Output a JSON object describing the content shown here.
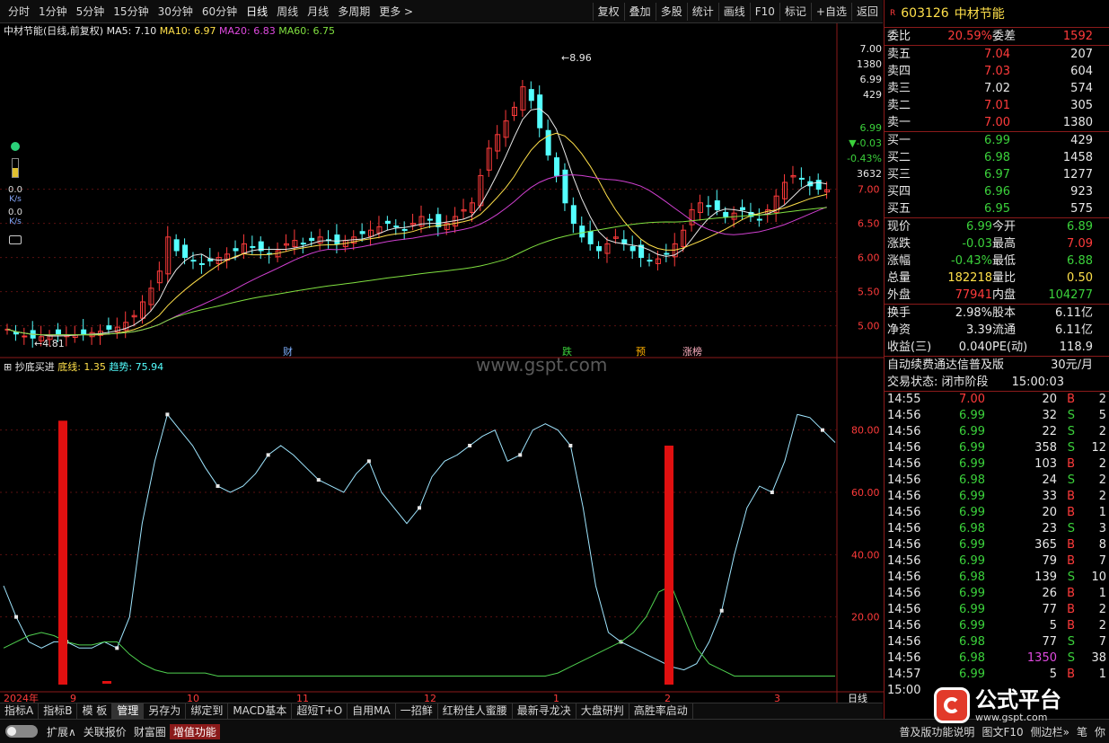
{
  "toolbar": {
    "left": [
      "分时",
      "1分钟",
      "5分钟",
      "15分钟",
      "30分钟",
      "60分钟",
      "日线",
      "周线",
      "月线",
      "多周期",
      "更多 >"
    ],
    "right": [
      "复权",
      "叠加",
      "多股",
      "统计",
      "画线",
      "F10",
      "标记",
      "+自选",
      "返回"
    ]
  },
  "chart_header": {
    "name": "中材节能",
    "mode": "(日线,前复权)",
    "ma5": "MA5: 7.10",
    "ma10": "MA10: 6.97",
    "ma20": "MA20: 6.83",
    "ma60": "MA60: 6.75"
  },
  "price_axis": [
    "7.00",
    "6.50",
    "6.00",
    "5.50",
    "5.00"
  ],
  "hover_box": [
    "7.00",
    "1380",
    "6.99",
    "429",
    "6.99",
    "-0.03",
    "-0.43%",
    "3632"
  ],
  "annotations": {
    "high": "8.96",
    "low": "4.81",
    "cai": "财",
    "die": "跌",
    "yu": "预",
    "zhangbang": "涨榜"
  },
  "indicator_header": {
    "name": "抄底买进",
    "base": "底线: 1.35",
    "trend": "趋势: 75.94"
  },
  "indicator_axis": [
    "80.00",
    "60.00",
    "40.00",
    "20.00"
  ],
  "x_axis": [
    "2024年",
    "9",
    "10",
    "11",
    "12",
    "1",
    "2",
    "3"
  ],
  "x_axis_unit": "日线",
  "watermark": "www.gspt.com",
  "side_tools": {
    "v1": "0.0",
    "u1": "K/s",
    "v2": "0.0",
    "u2": "K/s"
  },
  "stock": {
    "code": "603126",
    "name": "中材节能"
  },
  "weibi": {
    "label1": "委比",
    "val1": "20.59%",
    "label2": "委差",
    "val2": "1592"
  },
  "asks": [
    {
      "label": "卖五",
      "price": "7.04",
      "vol": "207"
    },
    {
      "label": "卖四",
      "price": "7.03",
      "vol": "604"
    },
    {
      "label": "卖三",
      "price": "7.02",
      "vol": "574"
    },
    {
      "label": "卖二",
      "price": "7.01",
      "vol": "305"
    },
    {
      "label": "卖一",
      "price": "7.00",
      "vol": "1380"
    }
  ],
  "bids": [
    {
      "label": "买一",
      "price": "6.99",
      "vol": "429"
    },
    {
      "label": "买二",
      "price": "6.98",
      "vol": "1458"
    },
    {
      "label": "买三",
      "price": "6.97",
      "vol": "1277"
    },
    {
      "label": "买四",
      "price": "6.96",
      "vol": "923"
    },
    {
      "label": "买五",
      "price": "6.95",
      "vol": "575"
    }
  ],
  "quote": [
    {
      "l1": "现价",
      "v1": "6.99",
      "l2": "今开",
      "v2": "6.89"
    },
    {
      "l1": "涨跌",
      "v1": "-0.03",
      "l2": "最高",
      "v2": "7.09"
    },
    {
      "l1": "涨幅",
      "v1": "-0.43%",
      "l2": "最低",
      "v2": "6.88"
    },
    {
      "l1": "总量",
      "v1": "182218",
      "l2": "量比",
      "v2": "0.50"
    },
    {
      "l1": "外盘",
      "v1": "77941",
      "l2": "内盘",
      "v2": "104277"
    }
  ],
  "fund": [
    {
      "l1": "换手",
      "v1": "2.98%",
      "l2": "股本",
      "v2": "6.11亿"
    },
    {
      "l1": "净资",
      "v1": "3.39",
      "l2": "流通",
      "v2": "6.11亿"
    },
    {
      "l1": "收益(三)",
      "v1": "0.040",
      "l2": "PE(动)",
      "v2": "118.9"
    }
  ],
  "service": {
    "text": "自动续费通达信普及版",
    "price": "30元/月"
  },
  "trade_status": {
    "label": "交易状态: 闭市阶段",
    "time": "15:00:03"
  },
  "ticks": [
    {
      "t": "14:55",
      "p": "7.00",
      "v": "20",
      "s": "B",
      "n": "2"
    },
    {
      "t": "14:56",
      "p": "6.99",
      "v": "32",
      "s": "S",
      "n": "5"
    },
    {
      "t": "14:56",
      "p": "6.99",
      "v": "22",
      "s": "S",
      "n": "2"
    },
    {
      "t": "14:56",
      "p": "6.99",
      "v": "358",
      "s": "S",
      "n": "12"
    },
    {
      "t": "14:56",
      "p": "6.99",
      "v": "103",
      "s": "B",
      "n": "2"
    },
    {
      "t": "14:56",
      "p": "6.98",
      "v": "24",
      "s": "S",
      "n": "2"
    },
    {
      "t": "14:56",
      "p": "6.99",
      "v": "33",
      "s": "B",
      "n": "2"
    },
    {
      "t": "14:56",
      "p": "6.99",
      "v": "20",
      "s": "B",
      "n": "1"
    },
    {
      "t": "14:56",
      "p": "6.98",
      "v": "23",
      "s": "S",
      "n": "3"
    },
    {
      "t": "14:56",
      "p": "6.99",
      "v": "365",
      "s": "B",
      "n": "8"
    },
    {
      "t": "14:56",
      "p": "6.99",
      "v": "79",
      "s": "B",
      "n": "7"
    },
    {
      "t": "14:56",
      "p": "6.98",
      "v": "139",
      "s": "S",
      "n": "10"
    },
    {
      "t": "14:56",
      "p": "6.99",
      "v": "26",
      "s": "B",
      "n": "1"
    },
    {
      "t": "14:56",
      "p": "6.99",
      "v": "77",
      "s": "B",
      "n": "2"
    },
    {
      "t": "14:56",
      "p": "6.99",
      "v": "5",
      "s": "B",
      "n": "2"
    },
    {
      "t": "14:56",
      "p": "6.98",
      "v": "77",
      "s": "S",
      "n": "7"
    },
    {
      "t": "14:56",
      "p": "6.98",
      "v": "1350",
      "s": "S",
      "n": "38"
    },
    {
      "t": "14:57",
      "p": "6.99",
      "v": "5",
      "s": "B",
      "n": "1"
    },
    {
      "t": "15:00",
      "p": "",
      "v": "",
      "s": "",
      "n": ""
    }
  ],
  "tabs1": [
    "指标A",
    "指标B",
    "模 板",
    "管理",
    "另存为",
    "绑定到",
    "MACD基本",
    "超短T+O",
    "自用MA",
    "一招鲜",
    "红粉佳人蜜腰",
    "最新寻龙决",
    "大盘研判",
    "高胜率启动"
  ],
  "tabs2": [
    "扩展∧",
    "关联报价",
    "财富圈",
    "增值功能"
  ],
  "tabs2_right": [
    "普及版功能说明",
    "图文F10",
    "侧边栏»",
    "笔",
    "你"
  ],
  "brand": {
    "text": "公式平台",
    "url": "www.gspt.com"
  },
  "colors": {
    "up": "#ff3b3b",
    "down": "#3bd13b",
    "cyan": "#54ffff",
    "magenta": "#d040d0",
    "green_ma": "#80e040",
    "bar": "#e01010"
  },
  "chart_data": [
    {
      "type": "candlestick",
      "title": "中材节能(日线,前复权)",
      "ylim": [
        4.6,
        9.1
      ],
      "y_ticks": [
        5.0,
        5.5,
        6.0,
        6.5,
        7.0
      ],
      "close_path": [
        4.95,
        4.88,
        4.85,
        4.82,
        4.84,
        4.86,
        4.88,
        4.87,
        4.86,
        4.88,
        4.9,
        4.92,
        4.95,
        4.98,
        5.05,
        5.15,
        5.35,
        5.55,
        5.8,
        6.3,
        6.1,
        6.0,
        5.95,
        5.9,
        5.95,
        6.0,
        6.05,
        6.1,
        6.2,
        6.15,
        6.1,
        6.05,
        6.1,
        6.2,
        6.25,
        6.2,
        6.25,
        6.3,
        6.25,
        6.2,
        6.25,
        6.3,
        6.35,
        6.4,
        6.45,
        6.5,
        6.45,
        6.4,
        6.5,
        6.6,
        6.55,
        6.45,
        6.5,
        6.6,
        6.7,
        6.8,
        7.2,
        7.6,
        7.8,
        8.0,
        8.2,
        8.5,
        8.3,
        7.9,
        7.5,
        7.2,
        6.8,
        6.5,
        6.3,
        6.2,
        6.1,
        6.2,
        6.3,
        6.2,
        6.1,
        6.0,
        5.95,
        5.98,
        6.05,
        6.2,
        6.4,
        6.7,
        6.8,
        6.75,
        6.7,
        6.6,
        6.65,
        6.7,
        6.6,
        6.55,
        6.7,
        6.9,
        7.1,
        7.2,
        7.15,
        7.05,
        7.0,
        6.99
      ],
      "high": 8.96,
      "low": 4.81
    },
    {
      "type": "line",
      "title": "抄底买进",
      "ylim": [
        0,
        90
      ],
      "y_ticks": [
        20,
        40,
        60,
        80
      ],
      "series": [
        {
          "name": "趋势",
          "values": [
            30,
            20,
            12,
            10,
            12,
            12,
            10,
            10,
            12,
            10,
            20,
            50,
            70,
            85,
            80,
            75,
            68,
            62,
            60,
            62,
            66,
            72,
            75,
            72,
            68,
            64,
            62,
            60,
            66,
            70,
            60,
            55,
            50,
            55,
            65,
            70,
            72,
            75,
            78,
            80,
            70,
            72,
            80,
            82,
            80,
            75,
            55,
            30,
            15,
            12,
            10,
            8,
            6,
            4,
            3,
            5,
            12,
            22,
            40,
            55,
            62,
            60,
            70,
            85,
            84,
            80,
            76
          ]
        },
        {
          "name": "底线",
          "values": [
            10,
            12,
            14,
            15,
            14,
            12,
            11,
            11,
            12,
            12,
            8,
            5,
            3,
            2,
            2,
            2,
            2,
            1,
            1,
            1,
            1,
            1,
            1,
            1,
            1,
            1,
            1,
            1,
            1,
            1,
            1,
            1,
            1,
            1,
            1,
            1,
            1,
            1,
            1,
            1,
            1,
            1,
            1,
            1,
            2,
            4,
            6,
            8,
            10,
            12,
            15,
            20,
            28,
            30,
            20,
            10,
            5,
            3,
            1,
            1,
            1,
            1,
            1,
            1,
            1,
            1,
            1
          ]
        },
        {
          "name": "抄底信号",
          "type": "bar",
          "values": [
            {
              "x": 70,
              "y": 83
            },
            {
              "x": 745,
              "y": 75
            }
          ]
        }
      ]
    }
  ]
}
